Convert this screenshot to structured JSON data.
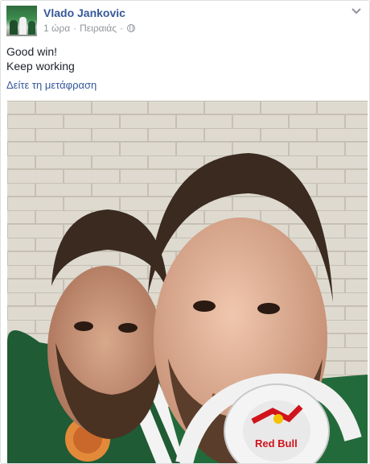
{
  "post": {
    "author": "Vlado Jankovic",
    "time": "1 ώρα",
    "separator": "·",
    "location": "Πειραιάς",
    "privacy_icon": "globe-icon",
    "menu_icon": "chevron-down-icon",
    "message_lines": [
      "Good win!",
      "Keep working"
    ],
    "translate_link": "Δείτε τη μετάφραση"
  },
  "photo": {
    "headphone_brand": "Red Bull"
  },
  "colors": {
    "link": "#365899",
    "meta": "#90949c",
    "text": "#1d2129"
  }
}
